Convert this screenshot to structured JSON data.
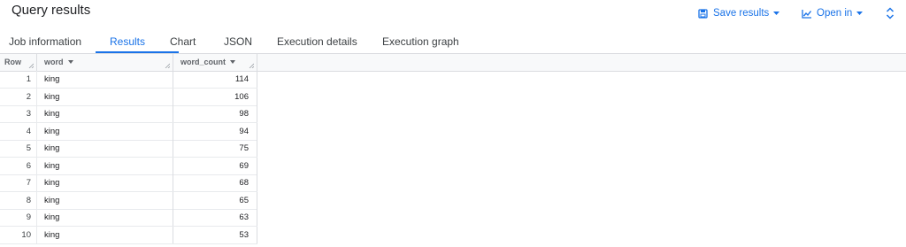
{
  "header": {
    "title": "Query results",
    "save_label": "Save results",
    "open_label": "Open in"
  },
  "tabs": [
    {
      "label": "Job information"
    },
    {
      "label": "Results"
    },
    {
      "label": "Chart"
    },
    {
      "label": "JSON"
    },
    {
      "label": "Execution details"
    },
    {
      "label": "Execution graph"
    }
  ],
  "active_tab": "Results",
  "table": {
    "columns": [
      "Row",
      "word",
      "word_count"
    ],
    "rows": [
      {
        "row": "1",
        "word": "king",
        "word_count": "114"
      },
      {
        "row": "2",
        "word": "king",
        "word_count": "106"
      },
      {
        "row": "3",
        "word": "king",
        "word_count": "98"
      },
      {
        "row": "4",
        "word": "king",
        "word_count": "94"
      },
      {
        "row": "5",
        "word": "king",
        "word_count": "75"
      },
      {
        "row": "6",
        "word": "king",
        "word_count": "69"
      },
      {
        "row": "7",
        "word": "king",
        "word_count": "68"
      },
      {
        "row": "8",
        "word": "king",
        "word_count": "65"
      },
      {
        "row": "9",
        "word": "king",
        "word_count": "63"
      },
      {
        "row": "10",
        "word": "king",
        "word_count": "53"
      }
    ]
  },
  "colors": {
    "accent": "#1a73e8",
    "text": "#202124",
    "border": "#dadce0"
  },
  "icons": [
    "save-icon",
    "chart-icon",
    "dropdown-arrow-icon",
    "expand-collapse-icon",
    "sort-arrow-icon",
    "resize-handle-icon"
  ]
}
